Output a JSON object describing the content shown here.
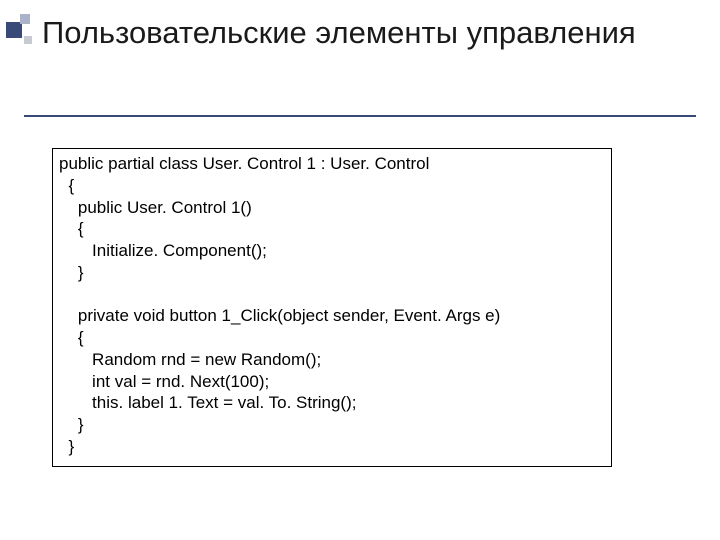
{
  "slide": {
    "title": "Пользовательские элементы управления",
    "code": "public partial class User. Control 1 : User. Control\n  {\n    public User. Control 1()\n    {\n       Initialize. Component();\n    }\n\n    private void button 1_Click(object sender, Event. Args e)\n    {\n       Random rnd = new Random();\n       int val = rnd. Next(100);\n       this. label 1. Text = val. To. String();\n    }\n  }"
  }
}
